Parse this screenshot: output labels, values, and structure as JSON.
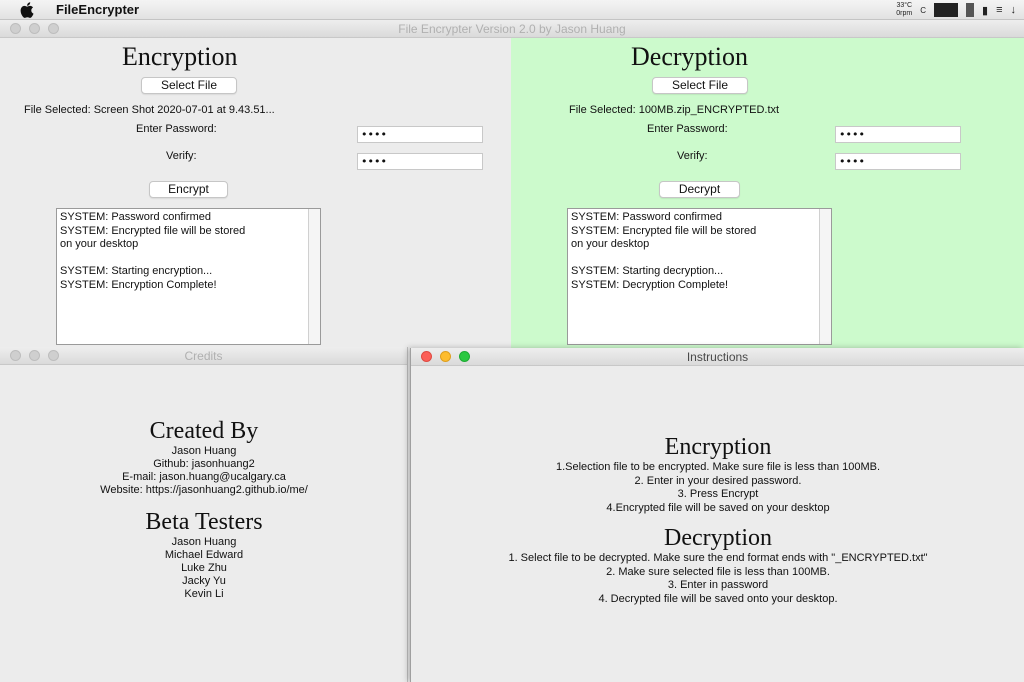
{
  "menubar": {
    "app_name": "FileEncrypter",
    "weather_temp": "33°C",
    "weather_time": "0rpm",
    "weather_c": "C",
    "icons": [
      "apple-icon",
      "cpu-graph-icon",
      "memory-icon",
      "battery-icon",
      "wifi-icon",
      "download-arrow-icon"
    ]
  },
  "main_window": {
    "title": "File Encrypter Version 2.0 by Jason Huang"
  },
  "encryption": {
    "heading": "Encryption",
    "select_label": "Select File",
    "file_selected": "File Selected: Screen Shot 2020-07-01 at 9.43.51...",
    "password_label": "Enter Password:",
    "password_value": "••••",
    "verify_label": "Verify:",
    "verify_value": "••••",
    "action_label": "Encrypt",
    "log": [
      "SYSTEM: Password confirmed",
      "SYSTEM: Encrypted file will be stored",
      "on your desktop",
      "",
      "SYSTEM: Starting encryption...",
      "SYSTEM: Encryption Complete!"
    ]
  },
  "decryption": {
    "heading": "Decryption",
    "select_label": "Select File",
    "file_selected": "File Selected: 100MB.zip_ENCRYPTED.txt",
    "password_label": "Enter Password:",
    "password_value": "••••",
    "verify_label": "Verify:",
    "verify_value": "••••",
    "action_label": "Decrypt",
    "log": [
      "SYSTEM: Password confirmed",
      "SYSTEM: Encrypted file will be stored",
      "on your desktop",
      "",
      "SYSTEM: Starting decryption...",
      "SYSTEM: Decryption Complete!"
    ],
    "background_color": "#ccfacc"
  },
  "credits": {
    "title": "Credits",
    "created_heading": "Created By",
    "author": "Jason Huang",
    "github": "Github: jasonhuang2",
    "email": "E-mail: jason.huang@ucalgary.ca",
    "website": "Website: https://jasonhuang2.github.io/me/",
    "testers_heading": "Beta Testers",
    "testers": [
      "Jason Huang",
      "Michael Edward",
      "Luke Zhu",
      "Jacky Yu",
      "Kevin Li"
    ]
  },
  "instructions": {
    "title": "Instructions",
    "enc_heading": "Encryption",
    "enc_steps": [
      "1.Selection file to be encrypted. Make sure file is less than 100MB.",
      "2. Enter in your desired password.",
      "3. Press Encrypt",
      "4.Encrypted file will be saved on your desktop"
    ],
    "dec_heading": "Decryption",
    "dec_steps": [
      "1. Select file to be decrypted. Make sure the end format ends with \"_ENCRYPTED.txt\"",
      "2. Make sure selected file is less than 100MB.",
      "3. Enter in password",
      "4. Decrypted file will be saved onto your desktop."
    ]
  }
}
